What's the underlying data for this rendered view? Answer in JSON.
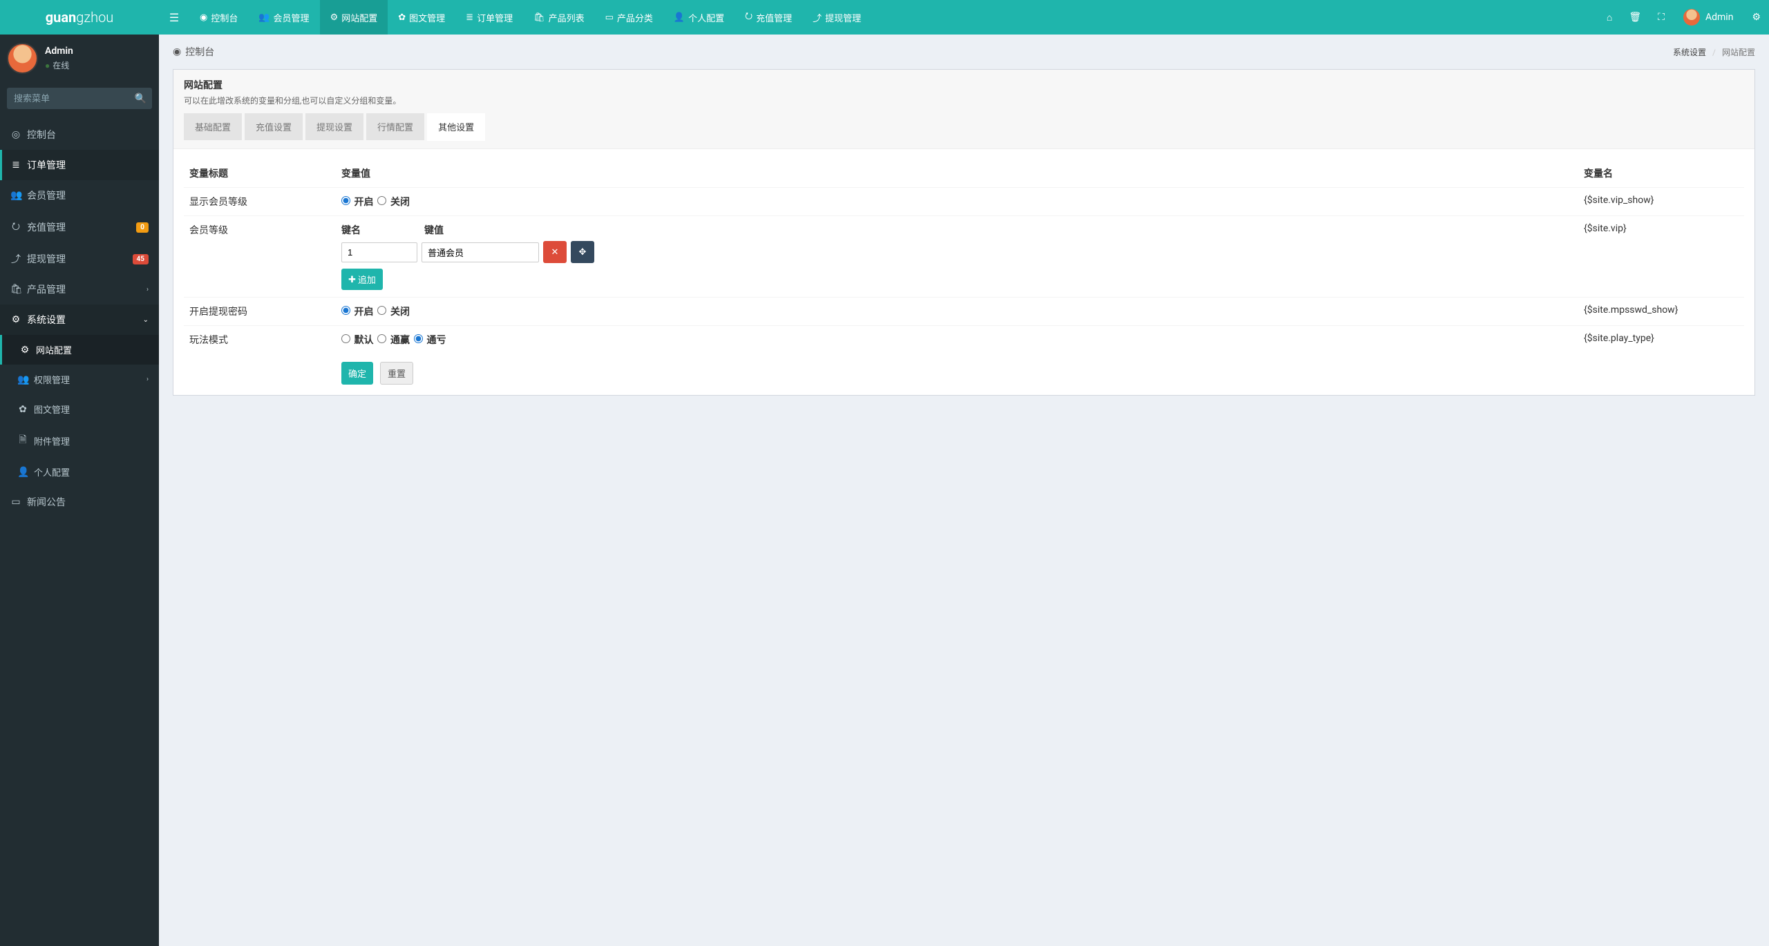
{
  "brand": {
    "part1": "guan",
    "part2": "g",
    "part3": "zhou"
  },
  "user": {
    "name": "Admin",
    "status": "在线"
  },
  "search": {
    "placeholder": "搜索菜单"
  },
  "sidebar": [
    {
      "icon": "◎",
      "label": "控制台"
    },
    {
      "icon": "≣",
      "label": "订单管理",
      "active": true
    },
    {
      "icon": "👥",
      "label": "会员管理"
    },
    {
      "icon": "⭮",
      "label": "充值管理",
      "badge": "0",
      "badgeClass": ""
    },
    {
      "icon": "⤴",
      "label": "提现管理",
      "badge": "45",
      "badgeClass": "red"
    },
    {
      "icon": "🛍",
      "label": "产品管理",
      "caret": "›"
    },
    {
      "icon": "⚙",
      "label": "系统设置",
      "caret": "⌄",
      "open": true
    },
    {
      "icon": "⚙",
      "label": "网站配置",
      "sub": true,
      "subactive": true
    },
    {
      "icon": "👥",
      "label": "权限管理",
      "sub": true,
      "caret": "›"
    },
    {
      "icon": "✿",
      "label": "图文管理",
      "sub": true
    },
    {
      "icon": "🗎",
      "label": "附件管理",
      "sub": true
    },
    {
      "icon": "👤",
      "label": "个人配置",
      "sub": true
    },
    {
      "icon": "▭",
      "label": "新闻公告"
    }
  ],
  "topnav": [
    {
      "icon": "◉",
      "label": "控制台"
    },
    {
      "icon": "👥",
      "label": "会员管理"
    },
    {
      "icon": "⚙",
      "label": "网站配置",
      "active": true
    },
    {
      "icon": "✿",
      "label": "图文管理"
    },
    {
      "icon": "≣",
      "label": "订单管理"
    },
    {
      "icon": "🛍",
      "label": "产品列表"
    },
    {
      "icon": "▭",
      "label": "产品分类"
    },
    {
      "icon": "👤",
      "label": "个人配置"
    },
    {
      "icon": "⭮",
      "label": "充值管理"
    },
    {
      "icon": "⤴",
      "label": "提现管理"
    }
  ],
  "topright": {
    "admin": "Admin"
  },
  "contentHeader": {
    "icon": "◉",
    "title": "控制台",
    "crumb1": "系统设置",
    "crumb2": "网站配置"
  },
  "panel": {
    "title": "网站配置",
    "desc": "可以在此增改系统的变量和分组,也可以自定义分组和变量。"
  },
  "tabs": [
    {
      "label": "基础配置"
    },
    {
      "label": "充值设置"
    },
    {
      "label": "提现设置"
    },
    {
      "label": "行情配置"
    },
    {
      "label": "其他设置",
      "active": true
    }
  ],
  "table": {
    "headers": {
      "title": "变量标题",
      "value": "变量值",
      "name": "变量名"
    },
    "rows": [
      {
        "title": "显示会员等级",
        "name": "{$site.vip_show}",
        "type": "radio2",
        "opts": [
          "开启",
          "关闭"
        ],
        "checked": 0
      },
      {
        "title": "会员等级",
        "name": "{$site.vip}",
        "type": "kv",
        "kheader": [
          "键名",
          "键值"
        ],
        "key": "1",
        "val": "普通会员",
        "append": "追加"
      },
      {
        "title": "开启提现密码",
        "name": "{$site.mpsswd_show}",
        "type": "radio2",
        "opts": [
          "开启",
          "关闭"
        ],
        "checked": 0
      },
      {
        "title": "玩法模式",
        "name": "{$site.play_type}",
        "type": "radio3",
        "opts": [
          "默认",
          "通赢",
          "通亏"
        ],
        "checked": 2
      }
    ]
  },
  "actions": {
    "submit": "确定",
    "reset": "重置"
  }
}
